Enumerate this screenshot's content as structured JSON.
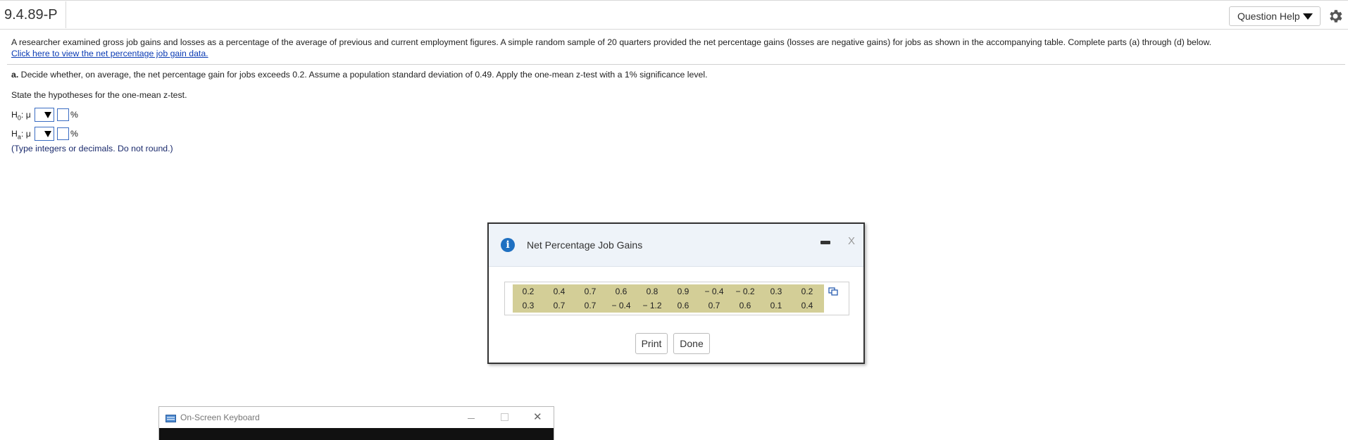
{
  "header": {
    "question_id": "9.4.89-P",
    "help_label": "Question Help"
  },
  "question": {
    "intro": "A researcher examined gross job gains and losses as a percentage of the average of previous and current employment figures. A simple random sample of 20 quarters provided the net percentage gains (losses are negative gains) for jobs as shown in the accompanying table. Complete parts (a) through (d) below.",
    "data_link": "Click here to view the net percentage job gain data.",
    "part_a_label": "a.",
    "part_a_text": " Decide whether, on average, the net percentage gain for jobs exceeds 0.2. Assume a population standard deviation of 0.49. Apply the one-mean z-test with a 1% significance level.",
    "state_prompt": "State the hypotheses for the one-mean z-test.",
    "h0_H": "H",
    "h0_sub": "0",
    "h0_mu": ": μ",
    "ha_H": "H",
    "ha_sub": "a",
    "ha_mu": ": μ",
    "unit": "%",
    "note": "(Type integers or decimals. Do not round.)"
  },
  "dialog": {
    "title": "Net Percentage Job Gains",
    "close_label": "X",
    "rows": [
      [
        "0.2",
        "0.4",
        "0.7",
        "0.6",
        "0.8",
        "0.9",
        "− 0.4",
        "− 0.2",
        "0.3",
        "0.2"
      ],
      [
        "0.3",
        "0.7",
        "0.7",
        "− 0.4",
        "− 1.2",
        "0.6",
        "0.7",
        "0.6",
        "0.1",
        "0.4"
      ]
    ],
    "print_label": "Print",
    "done_label": "Done"
  },
  "osk": {
    "title": "On-Screen Keyboard",
    "close_label": "✕"
  },
  "colors": {
    "link": "#0a3bb4",
    "table_bg": "#d3ce97",
    "info_icon": "#1f70c1",
    "dialog_header": "#eef3f9"
  }
}
